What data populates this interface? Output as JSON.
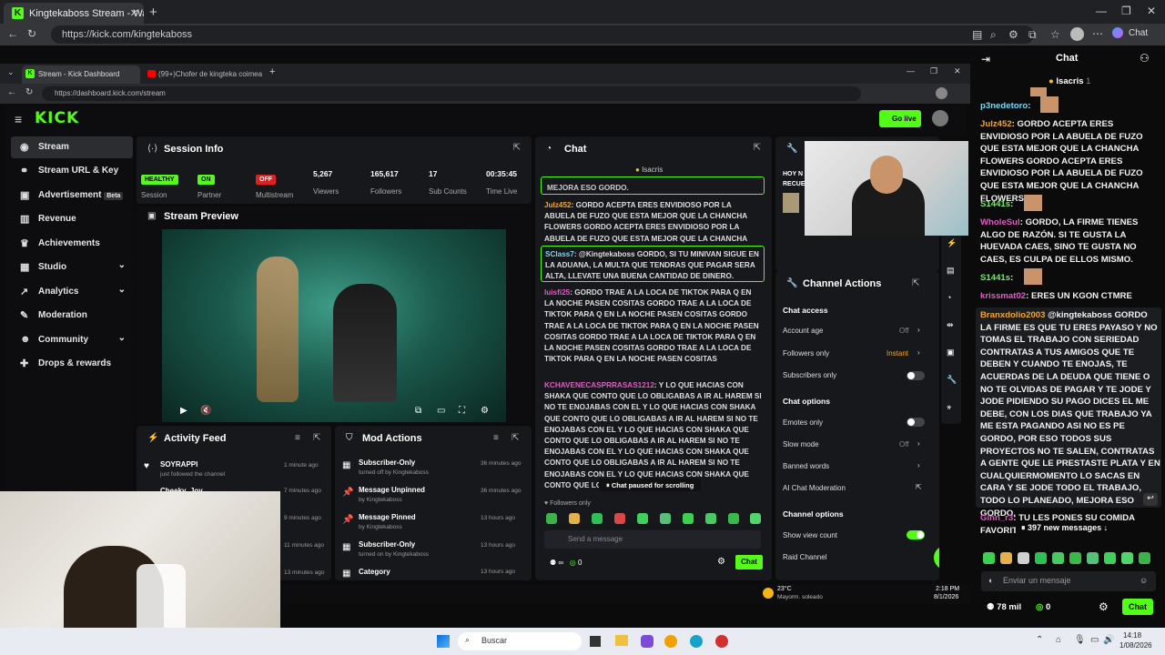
{
  "browser": {
    "tab_title": "Kingtekaboss Stream - Watch",
    "url": "https://kick.com/kingtekaboss",
    "chat_button": "Chat"
  },
  "inner_browser": {
    "tab1": "Stream - Kick Dashboard",
    "tab2": "(99+)Chofer de kingteka coimea c",
    "url": "https://dashboard.kick.com/stream",
    "go_live": "Go live"
  },
  "sidebar": {
    "items": [
      {
        "label": "Stream"
      },
      {
        "label": "Stream URL & Key"
      },
      {
        "label": "Advertisement",
        "badge": "Beta"
      },
      {
        "label": "Revenue"
      },
      {
        "label": "Achievements"
      },
      {
        "label": "Studio"
      },
      {
        "label": "Analytics"
      },
      {
        "label": "Moderation"
      },
      {
        "label": "Community"
      },
      {
        "label": "Drops & rewards"
      }
    ]
  },
  "session": {
    "title": "Session Info",
    "stats": [
      {
        "value": "HEALTHY",
        "label": "Session"
      },
      {
        "value": "ON",
        "label": "Partner"
      },
      {
        "value": "OFF",
        "label": "Multistream"
      },
      {
        "value": "5,267",
        "label": "Viewers"
      },
      {
        "value": "165,617",
        "label": "Followers"
      },
      {
        "value": "17",
        "label": "Sub Counts"
      },
      {
        "value": "00:35:45",
        "label": "Time Live"
      }
    ]
  },
  "preview": {
    "title": "Stream Preview"
  },
  "activity": {
    "title": "Activity Feed",
    "items": [
      {
        "name": "SOYRAPPI",
        "sub": "just followed the channel",
        "time": "1 minute ago"
      },
      {
        "name": "Cheeky_Joy",
        "sub": "",
        "time": "7 minutes ago"
      },
      {
        "name": "",
        "sub": "",
        "time": "9 minutes ago"
      },
      {
        "name": "",
        "sub": "",
        "time": "11 minutes ago"
      },
      {
        "name": "",
        "sub": "",
        "time": "13 minutes ago"
      }
    ]
  },
  "mod_actions": {
    "title": "Mod Actions",
    "items": [
      {
        "name": "Subscriber-Only",
        "sub": "turned off by Kingtekaboss",
        "time": "36 minutes ago"
      },
      {
        "name": "Message Unpinned",
        "sub": "by Kingtekaboss",
        "time": "36 minutes ago"
      },
      {
        "name": "Message Pinned",
        "sub": "by Kingtekaboss",
        "time": "13 hours ago"
      },
      {
        "name": "Subscriber-Only",
        "sub": "turned on by Kingtekaboss",
        "time": "13 hours ago"
      },
      {
        "name": "Category",
        "sub": "",
        "time": "13 hours ago"
      }
    ]
  },
  "inner_chat": {
    "title": "Chat",
    "pinned": "Isacris",
    "lines": [
      {
        "user": "",
        "text": "MEJORA ESO GORDO."
      },
      {
        "user": "Julz452",
        "text": "GORDO ACEPTA ERES ENVIDIOSO POR LA ABUELA DE FUZO QUE ESTA MEJOR QUE LA CHANCHA FLOWERS GORDO ACEPTA ERES ENVIDIOSO POR LA ABUELA DE FUZO QUE ESTA MEJOR QUE LA CHANCHA FLOWERS"
      },
      {
        "user": "SClass7",
        "text": "@Kingtekaboss GORDO, SI TU MINIVAN SIGUE EN LA ADUANA, LA MULTA QUE TENDRAS QUE PAGAR SERA ALTA, LLEVATE UNA BUENA CANTIDAD DE DINERO."
      },
      {
        "user": "luisfi25",
        "text": "GORDO TRAE A LA LOCA DE TIKTOK PARA Q EN LA NOCHE PASEN COSITAS GORDO TRAE A LA LOCA DE TIKTOK PARA Q EN LA NOCHE PASEN COSITAS GORDO TRAE A LA LOCA DE TIKTOK PARA Q EN LA NOCHE PASEN COSITAS GORDO TRAE A LA LOCA DE TIKTOK PARA Q EN LA NOCHE PASEN COSITAS GORDO TRAE A LA LOCA DE TIKTOK PARA Q EN LA NOCHE PASEN COSITAS"
      },
      {
        "user": "KCHAVENECASPRRASAS1212",
        "text": "Y LO QUE HACIAS CON SHAKA QUE CONTO QUE LO OBLIGABAS A IR AL HAREM SI NO TE ENOJABAS CON EL Y LO QUE HACIAS CON SHAKA QUE CONTO QUE LO OBLIGABAS A IR AL HAREM SI NO TE ENOJABAS CON EL Y LO QUE HACIAS CON SHAKA QUE CONTO QUE LO OBLIGABAS A IR AL HAREM SI NO TE ENOJABAS CON EL Y LO QUE HACIAS CON SHAKA QUE CONTO QUE LO OBLIGABAS A IR AL HAREM SI NO TE ENOJABAS CON EL Y LO QUE HACIAS CON SHAKA QUE CONTO QUE LO"
      }
    ],
    "paused": "Chat paused for scrolling",
    "followers_only": "Followers only",
    "placeholder": "Send a message",
    "count": "0",
    "send": "Chat"
  },
  "channel_actions": {
    "title": "Channel Actions",
    "chat_access": "Chat access",
    "account_age": "Account age",
    "account_age_val": "Off",
    "followers_only": "Followers only",
    "followers_only_val": "Instant",
    "subscribers_only": "Subscribers only",
    "chat_options": "Chat options",
    "emotes_only": "Emotes only",
    "slow_mode": "Slow mode",
    "slow_mode_val": "Off",
    "banned_words": "Banned words",
    "ai_moderation": "AI Chat Moderation",
    "channel_options": "Channel options",
    "show_view_count": "Show view count",
    "raid_channel": "Raid Channel"
  },
  "partial_panel": {
    "line1": "HOY N",
    "line2": "RECUE"
  },
  "inner_taskbar": {
    "temp": "23°C",
    "weather": "Mayorm. soleado",
    "time": "2:18 PM",
    "date": "8/1/2026"
  },
  "right_chat": {
    "title": "Chat",
    "pinned": "Isacris",
    "pinned_count": "1",
    "messages": [
      {
        "user": "p3nedetoro",
        "text": "",
        "color": "#7ad7f0"
      },
      {
        "user": "Julz452",
        "text": "GORDO ACEPTA ERES ENVIDIOSO POR LA ABUELA DE FUZO QUE ESTA MEJOR QUE LA CHANCHA FLOWERS GORDO ACEPTA ERES ENVIDIOSO POR LA ABUELA DE FUZO QUE ESTA MEJOR QUE LA CHANCHA FLOWERS",
        "color": "#f5a623"
      },
      {
        "user": "S1441s",
        "text": "",
        "color": "#7ee36f"
      },
      {
        "user": "WholeSul",
        "text": "GORDO, LA FIRME TIENES ALGO DE RAZÓN. SI TE GUSTA LA HUEVADA CAES, SINO TE GUSTA NO CAES, ES CULPA DE ELLOS MISMO.",
        "color": "#e05cc4"
      },
      {
        "user": "S1441s",
        "text": "",
        "color": "#7ee36f"
      },
      {
        "user": "krissmat02",
        "text": "ERES UN KGON CTMRE",
        "color": "#e05cc4"
      },
      {
        "user": "Branxdolio2003",
        "text": "@kingtekaboss GORDO LA FIRME ES QUE TU ERES PAYASO Y NO TOMAS EL TRABAJO CON SERIEDAD CONTRATAS A TUS AMIGOS QUE TE DEBEN Y CUANDO TE ENOJAS, TE ACUERDAS DE LA DEUDA QUE TIENE O NO TE OLVIDAS DE PAGAR Y TE JODE Y JODE PIDIENDO SU PAGO DICES EL ME DEBE, CON LOS DIAS QUE TRABAJO YA ME ESTA PAGANDO ASI NO ES PE GORDO, POR ESO TODOS SUS PROYECTOS NO TE SALEN, CONTRATAS A GENTE QUE LE PRESTASTE PLATA Y EN CUALQUIERMOMENTO LO SACAS EN CARA Y SE JODE TODO EL TRABAJO, TODO LO PLANEADO, MEJORA ESO GORDO.",
        "color": "#f5a623"
      },
      {
        "user": "Ginn_r3",
        "text": "TU LES PONES SU COMIDA FAVORITA",
        "color": "#e05cc4"
      }
    ],
    "new_messages": "397 new messages",
    "placeholder": "Enviar un mensaje",
    "viewers": "78 mil",
    "count": "0",
    "send": "Chat"
  },
  "taskbar": {
    "search": "Buscar",
    "time": "14:18",
    "date": "1/08/2026"
  }
}
